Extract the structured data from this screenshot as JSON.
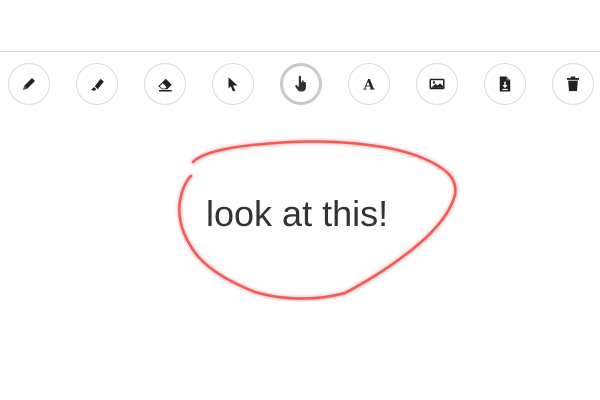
{
  "toolbar": {
    "tools": [
      {
        "id": "pen",
        "icon": "pen-icon",
        "active": false
      },
      {
        "id": "highlighter",
        "icon": "highlighter-icon",
        "active": false
      },
      {
        "id": "eraser",
        "icon": "eraser-icon",
        "active": false
      },
      {
        "id": "select",
        "icon": "pointer-icon",
        "active": false
      },
      {
        "id": "hand",
        "icon": "hand-pointer-icon",
        "active": true
      },
      {
        "id": "text",
        "icon": "text-icon",
        "active": false
      },
      {
        "id": "image",
        "icon": "image-icon",
        "active": false
      },
      {
        "id": "download",
        "icon": "download-file-icon",
        "active": false
      },
      {
        "id": "delete",
        "icon": "trash-icon",
        "active": false
      }
    ]
  },
  "canvas": {
    "text_annotation": "look at this!",
    "stroke_color": "#f25a5a"
  }
}
